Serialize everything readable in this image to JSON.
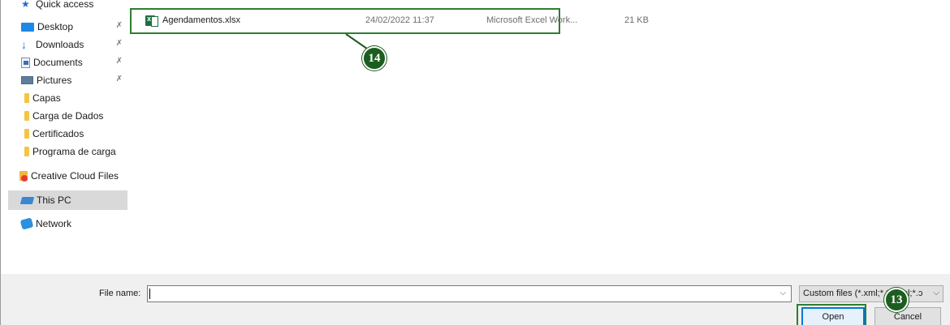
{
  "nav": {
    "items": [
      {
        "label": "Quick access",
        "icon": "star-icon"
      },
      {
        "label": "Desktop",
        "icon": "desktop-icon",
        "pinned": true
      },
      {
        "label": "Downloads",
        "icon": "download-icon",
        "pinned": true
      },
      {
        "label": "Documents",
        "icon": "documents-icon",
        "pinned": true
      },
      {
        "label": "Pictures",
        "icon": "pictures-icon",
        "pinned": true
      },
      {
        "label": "Capas",
        "icon": "folder-icon"
      },
      {
        "label": "Carga de Dados",
        "icon": "folder-icon"
      },
      {
        "label": "Certificados",
        "icon": "folder-icon"
      },
      {
        "label": "Programa de carga",
        "icon": "folder-icon"
      },
      {
        "label": "Creative Cloud Files",
        "icon": "creative-cloud-icon"
      },
      {
        "label": "This PC",
        "icon": "pc-icon",
        "selected": true
      },
      {
        "label": "Network",
        "icon": "network-icon"
      }
    ],
    "pin_glyph": "📌"
  },
  "files": [
    {
      "name": "Agendamentos.xlsx",
      "date": "24/02/2022 11:37",
      "type": "Microsoft Excel Work...",
      "size": "21 KB"
    }
  ],
  "footer": {
    "file_name_label": "File name:",
    "file_name_value": "",
    "filter_value": "Custom files (*.xml;*.*;*.dbl;*.ɔ",
    "open_label": "Open",
    "cancel_label": "Cancel"
  },
  "callouts": {
    "file_step": "14",
    "open_step": "13"
  },
  "colors": {
    "highlight": "#2e7d32",
    "callout": "#1b5e20",
    "selected_nav": "#d9d9d9"
  }
}
